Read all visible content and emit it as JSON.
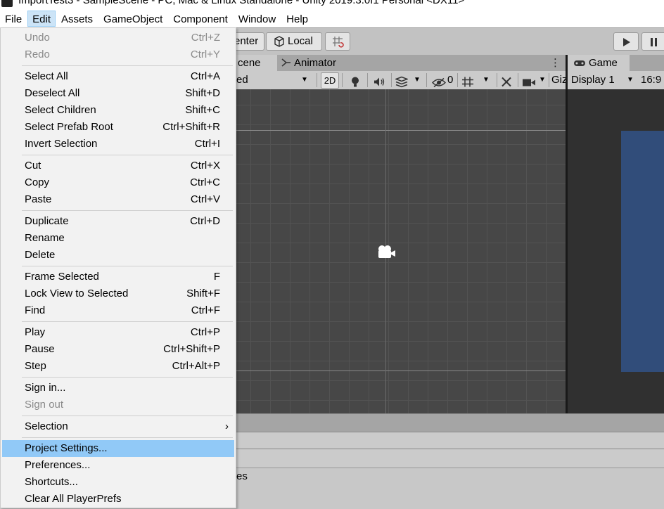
{
  "window": {
    "title": "ImportTest3 - SampleScene - PC, Mac & Linux Standalone - Unity 2019.3.0f1 Personal <DX11>"
  },
  "menubar": {
    "items": [
      "File",
      "Edit",
      "Assets",
      "GameObject",
      "Component",
      "Window",
      "Help"
    ],
    "active": "Edit"
  },
  "toolbar": {
    "pivot_label": "enter",
    "local_label": "Local"
  },
  "scene_panel": {
    "scene_tab": "cene",
    "animator_tab": "Animator",
    "shading_mode": "ed",
    "mode_2d": "2D",
    "hidden_count": "0",
    "gizmos_label": "Giz"
  },
  "game_panel": {
    "tab": "Game",
    "display": "Display 1",
    "aspect": "16:9"
  },
  "bottom": {
    "text": "es"
  },
  "edit_menu": {
    "items": [
      {
        "label": "Undo",
        "shortcut": "Ctrl+Z",
        "disabled": true
      },
      {
        "label": "Redo",
        "shortcut": "Ctrl+Y",
        "disabled": true
      },
      {
        "label": "Select All",
        "shortcut": "Ctrl+A"
      },
      {
        "label": "Deselect All",
        "shortcut": "Shift+D"
      },
      {
        "label": "Select Children",
        "shortcut": "Shift+C"
      },
      {
        "label": "Select Prefab Root",
        "shortcut": "Ctrl+Shift+R"
      },
      {
        "label": "Invert Selection",
        "shortcut": "Ctrl+I"
      },
      {
        "label": "Cut",
        "shortcut": "Ctrl+X"
      },
      {
        "label": "Copy",
        "shortcut": "Ctrl+C"
      },
      {
        "label": "Paste",
        "shortcut": "Ctrl+V"
      },
      {
        "label": "Duplicate",
        "shortcut": "Ctrl+D"
      },
      {
        "label": "Rename",
        "shortcut": ""
      },
      {
        "label": "Delete",
        "shortcut": ""
      },
      {
        "label": "Frame Selected",
        "shortcut": "F"
      },
      {
        "label": "Lock View to Selected",
        "shortcut": "Shift+F"
      },
      {
        "label": "Find",
        "shortcut": "Ctrl+F"
      },
      {
        "label": "Play",
        "shortcut": "Ctrl+P"
      },
      {
        "label": "Pause",
        "shortcut": "Ctrl+Shift+P"
      },
      {
        "label": "Step",
        "shortcut": "Ctrl+Alt+P"
      },
      {
        "label": "Sign in...",
        "shortcut": ""
      },
      {
        "label": "Sign out",
        "shortcut": "",
        "disabled": true
      },
      {
        "label": "Selection",
        "shortcut": "›",
        "submenu": true
      },
      {
        "label": "Project Settings...",
        "shortcut": "",
        "highlighted": true
      },
      {
        "label": "Preferences...",
        "shortcut": ""
      },
      {
        "label": "Shortcuts...",
        "shortcut": ""
      },
      {
        "label": "Clear All PlayerPrefs",
        "shortcut": ""
      }
    ]
  },
  "colors": {
    "menu_highlight": "#91c9f7",
    "scene_background": "#474747",
    "game_camera_background": "#314d7a"
  }
}
